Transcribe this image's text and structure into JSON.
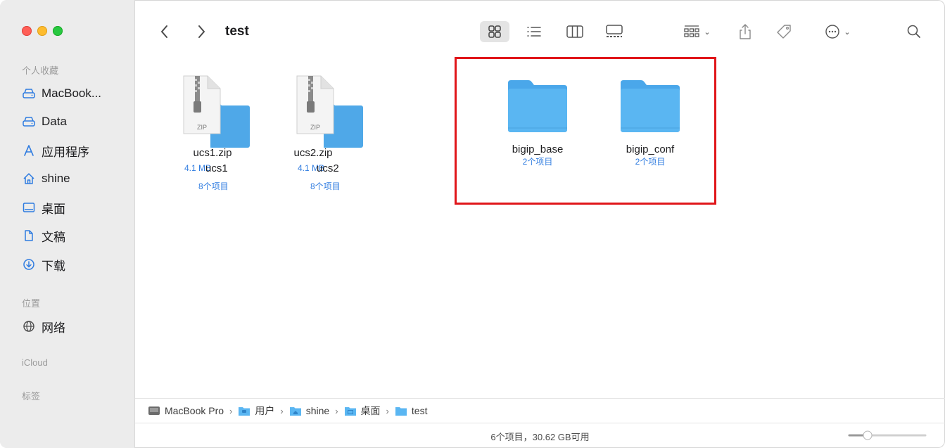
{
  "window": {
    "title": "test"
  },
  "sidebar": {
    "favorites_header": "个人收藏",
    "favorites": [
      {
        "label": "MacBook...",
        "icon": "drive-icon"
      },
      {
        "label": "Data",
        "icon": "drive-icon"
      },
      {
        "label": "应用程序",
        "icon": "applications-icon"
      },
      {
        "label": "shine",
        "icon": "home-icon"
      },
      {
        "label": "桌面",
        "icon": "desktop-icon"
      },
      {
        "label": "文稿",
        "icon": "document-icon"
      },
      {
        "label": "下载",
        "icon": "download-icon"
      }
    ],
    "locations_header": "位置",
    "locations": [
      {
        "label": "网络",
        "icon": "network-icon"
      }
    ],
    "icloud_header": "iCloud",
    "tags_header": "标签"
  },
  "files": [
    {
      "name": "ucs1.zip",
      "size": "4.1 MB",
      "type": "zip",
      "icon_label": "ZIP",
      "overlay_name": "ucs1",
      "overlay_count": "8个项目"
    },
    {
      "name": "ucs2.zip",
      "size": "4.1 MB",
      "type": "zip",
      "icon_label": "ZIP",
      "overlay_name": "ucs2",
      "overlay_count": "8个项目"
    },
    {
      "name": "bigip_base",
      "count": "2个项目",
      "type": "folder"
    },
    {
      "name": "bigip_conf",
      "count": "2个项目",
      "type": "folder"
    }
  ],
  "pathbar": [
    {
      "label": "MacBook Pro",
      "icon": "hard-drive-icon"
    },
    {
      "label": "用户",
      "icon": "folder-icon"
    },
    {
      "label": "shine",
      "icon": "home-folder-icon"
    },
    {
      "label": "桌面",
      "icon": "desktop-folder-icon"
    },
    {
      "label": "test",
      "icon": "folder-icon"
    }
  ],
  "status": {
    "text": "6个项目，30.62 GB可用"
  },
  "colors": {
    "folder": "#5ab6f2",
    "link_blue": "#2f7ce0",
    "highlight": "#e0161a"
  }
}
